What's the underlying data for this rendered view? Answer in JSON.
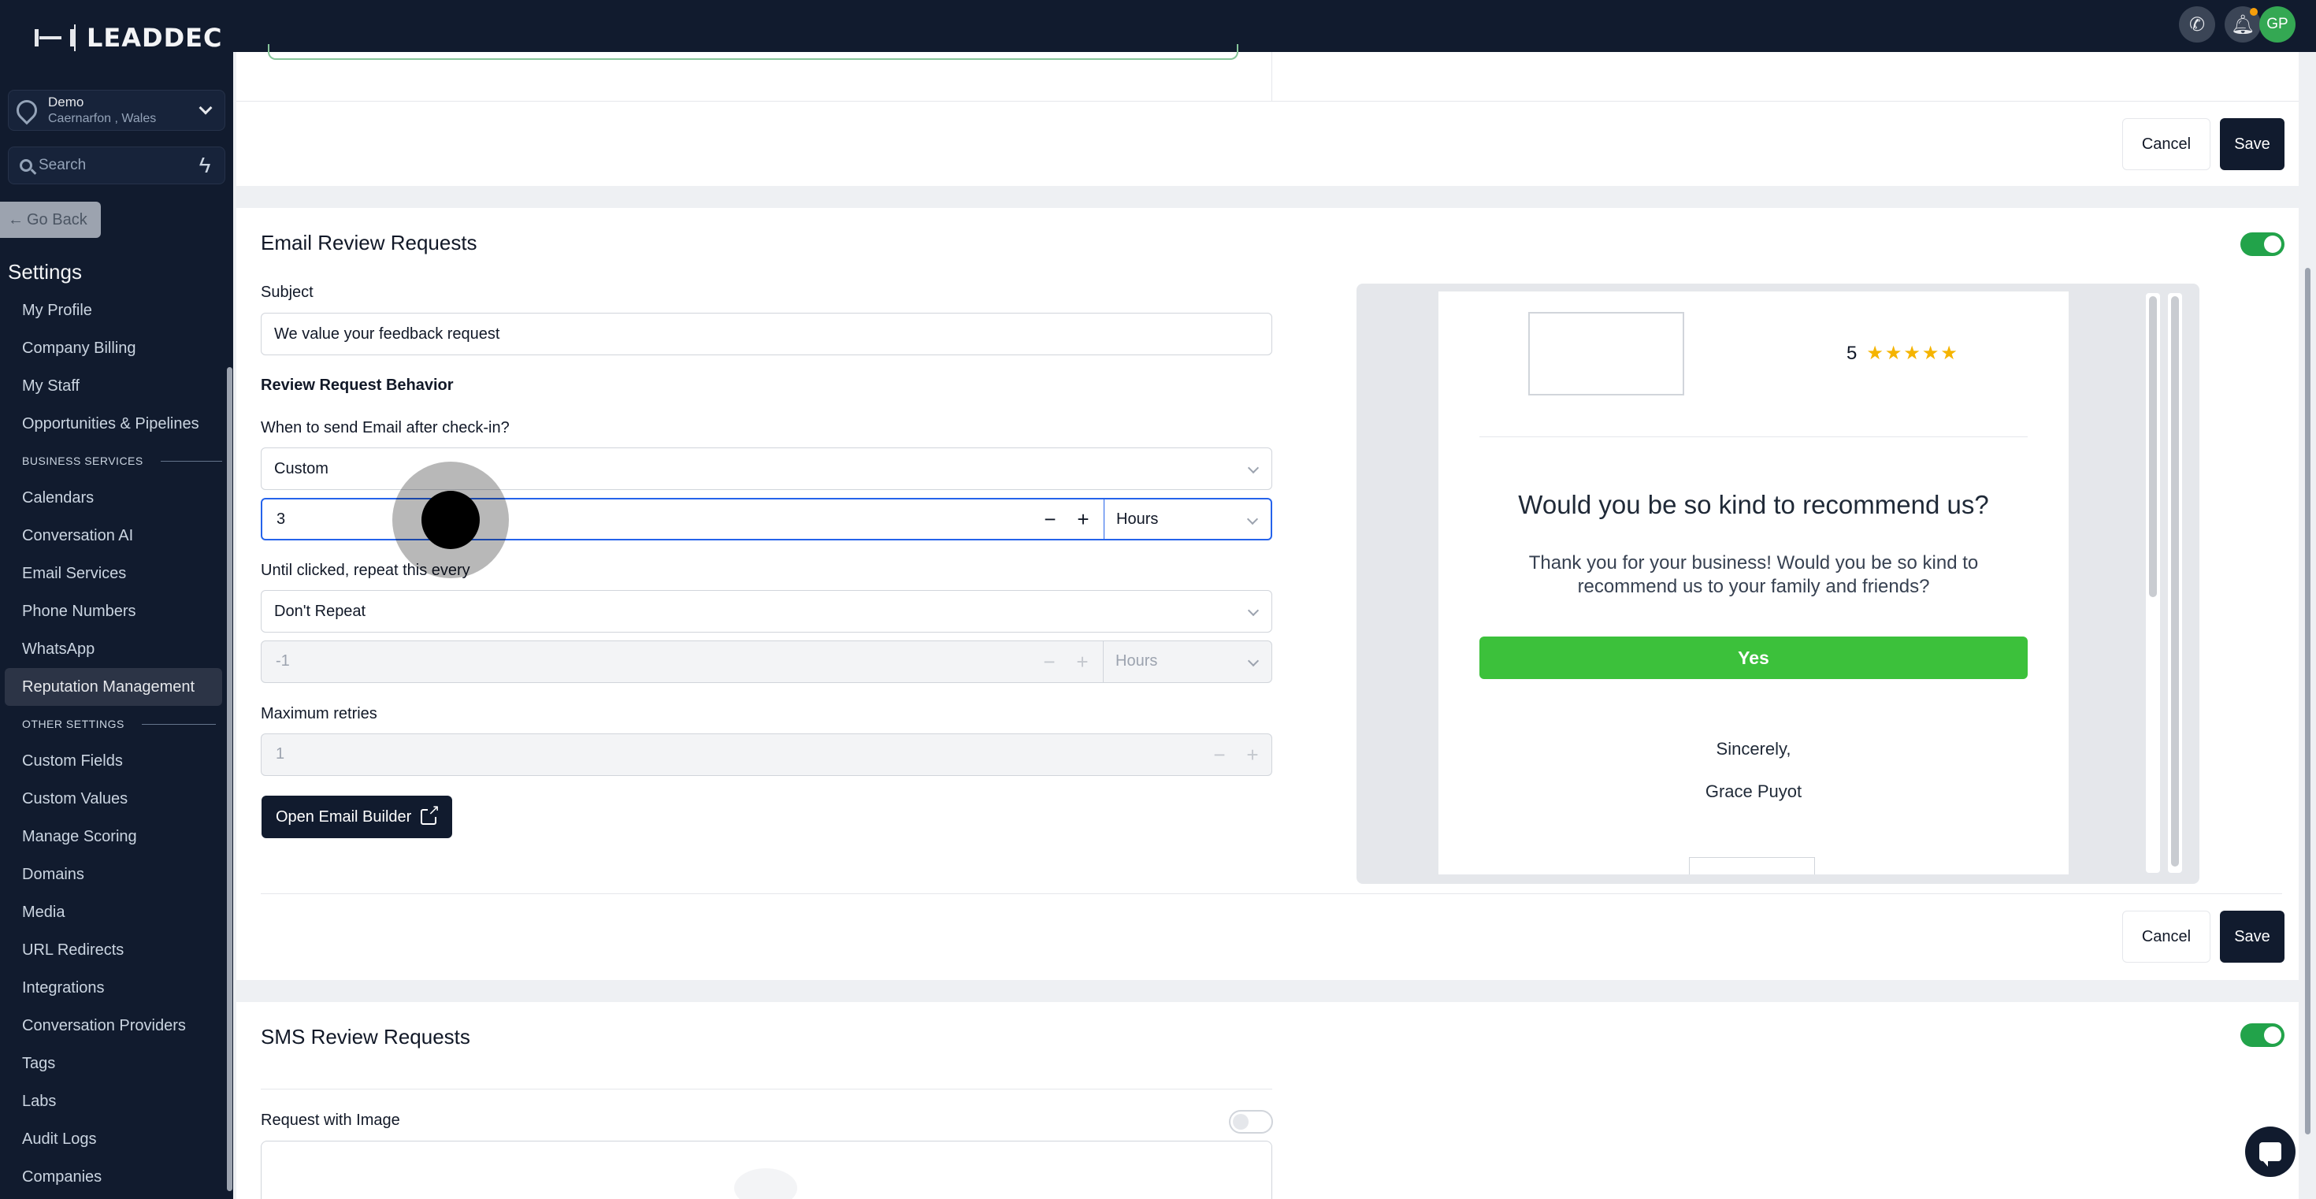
{
  "brand": {
    "name": "LEADDEC"
  },
  "location": {
    "name": "Demo",
    "address": "Caernarfon , Wales"
  },
  "search": {
    "placeholder": "Search"
  },
  "sidebar": {
    "go_back": "Go Back",
    "settings_title": "Settings",
    "items_top": [
      "My Profile",
      "Company Billing",
      "My Staff",
      "Opportunities & Pipelines"
    ],
    "section_business": "BUSINESS SERVICES",
    "items_business": [
      "Calendars",
      "Conversation AI",
      "Email Services",
      "Phone Numbers",
      "WhatsApp",
      "Reputation Management"
    ],
    "active_item": "Reputation Management",
    "section_other": "OTHER SETTINGS",
    "items_other": [
      "Custom Fields",
      "Custom Values",
      "Manage Scoring",
      "Domains",
      "Media",
      "URL Redirects",
      "Integrations",
      "Conversation Providers",
      "Tags",
      "Labs",
      "Audit Logs",
      "Companies"
    ]
  },
  "topbar": {
    "avatar_initials": "GP",
    "icons": [
      "phone-icon",
      "bell-icon"
    ]
  },
  "top_card": {
    "cancel": "Cancel",
    "save": "Save"
  },
  "email_review": {
    "title": "Email Review Requests",
    "enabled": true,
    "subject_label": "Subject",
    "subject_value": "We value your feedback request",
    "behavior_heading": "Review Request Behavior",
    "when_label": "When to send Email after check-in?",
    "when_value": "Custom",
    "delay_value": "3",
    "delay_unit": "Hours",
    "repeat_label": "Until clicked, repeat this every",
    "repeat_value": "Don't Repeat",
    "repeat_count": "-1",
    "repeat_unit": "Hours",
    "max_retries_label": "Maximum retries",
    "max_retries_value": "1",
    "builder_button": "Open Email Builder",
    "cancel": "Cancel",
    "save": "Save"
  },
  "preview": {
    "rating": "5",
    "stars": "★★★★★",
    "headline": "Would you be so kind to recommend us?",
    "body": "Thank you for your business! Would you be so kind to recommend us to your family and friends?",
    "yes_button": "Yes",
    "sign_off": "Sincerely,",
    "signature": "Grace Puyot"
  },
  "sms_review": {
    "title": "SMS Review Requests",
    "enabled": true,
    "image_label": "Request with Image",
    "image_enabled": false
  }
}
